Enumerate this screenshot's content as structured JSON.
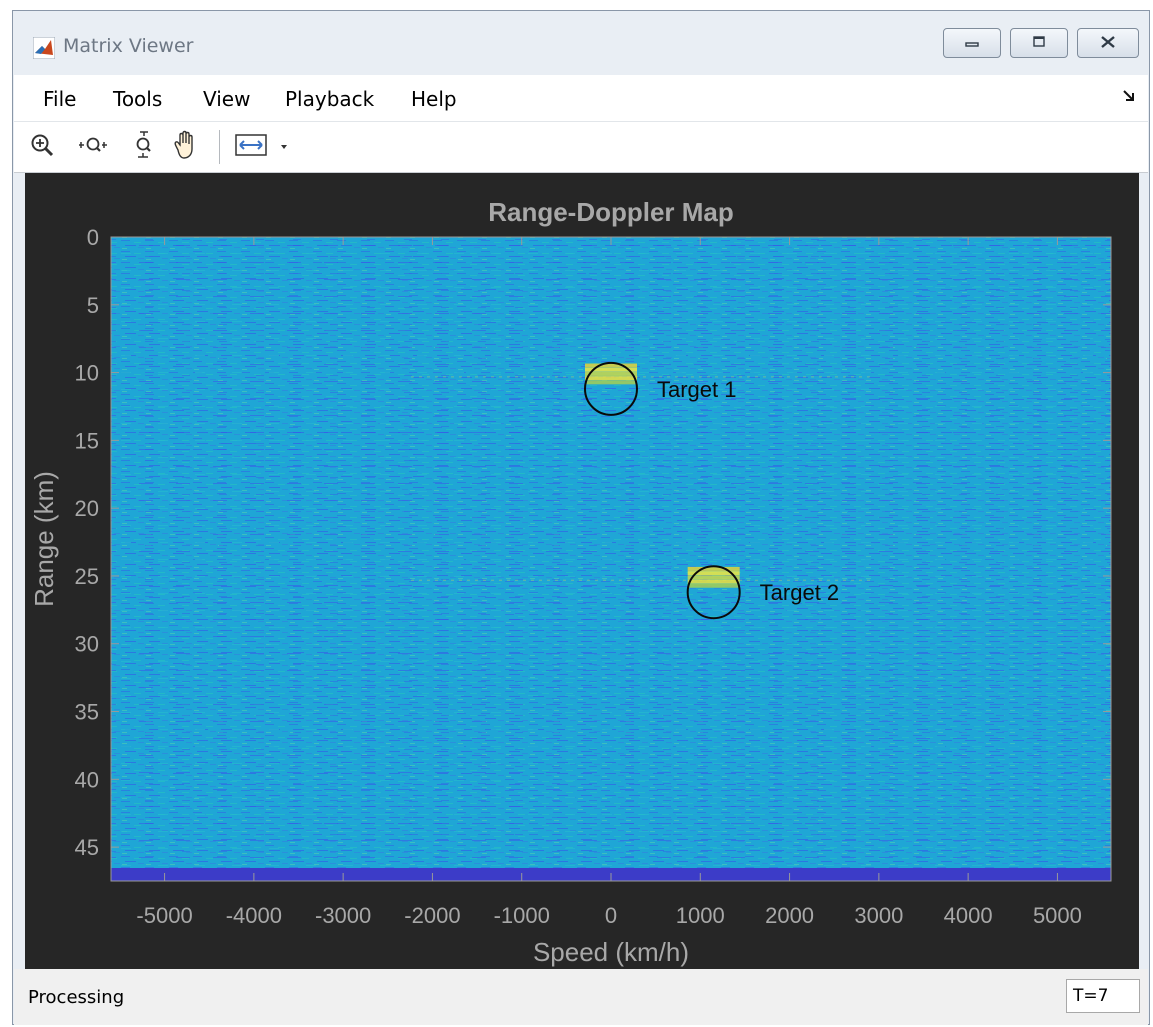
{
  "window": {
    "title": "Matrix Viewer",
    "controls": {
      "minimize": "minimize",
      "maximize": "maximize",
      "close": "close"
    }
  },
  "menu": {
    "items": [
      "File",
      "Tools",
      "View",
      "Playback",
      "Help"
    ],
    "dock_icon": "undock-arrow-icon"
  },
  "toolbar": {
    "buttons": [
      "zoom-in-icon",
      "zoom-x-icon",
      "zoom-y-icon",
      "pan-hand-icon",
      "fit-to-view-icon"
    ],
    "dropdown_icon": "chevron-down-icon"
  },
  "chart_data": {
    "type": "heatmap",
    "title": "Range-Doppler Map",
    "xlabel": "Speed (km/h)",
    "ylabel": "Range (km)",
    "xlim": [
      -5600,
      5600
    ],
    "ylim": [
      0,
      47.5
    ],
    "y_reversed": true,
    "x_ticks": [
      -5000,
      -4000,
      -3000,
      -2000,
      -1000,
      0,
      1000,
      2000,
      3000,
      4000,
      5000
    ],
    "y_ticks": [
      0,
      5,
      10,
      15,
      20,
      25,
      30,
      35,
      40,
      45
    ],
    "colormap": "parula",
    "background_color": "#1fa6d6",
    "annotations": [
      {
        "label": "Target 1",
        "x": 0,
        "y": 11.2
      },
      {
        "label": "Target 2",
        "x": 1150,
        "y": 26.2
      }
    ]
  },
  "status": {
    "text": "Processing",
    "time": "T=7"
  }
}
